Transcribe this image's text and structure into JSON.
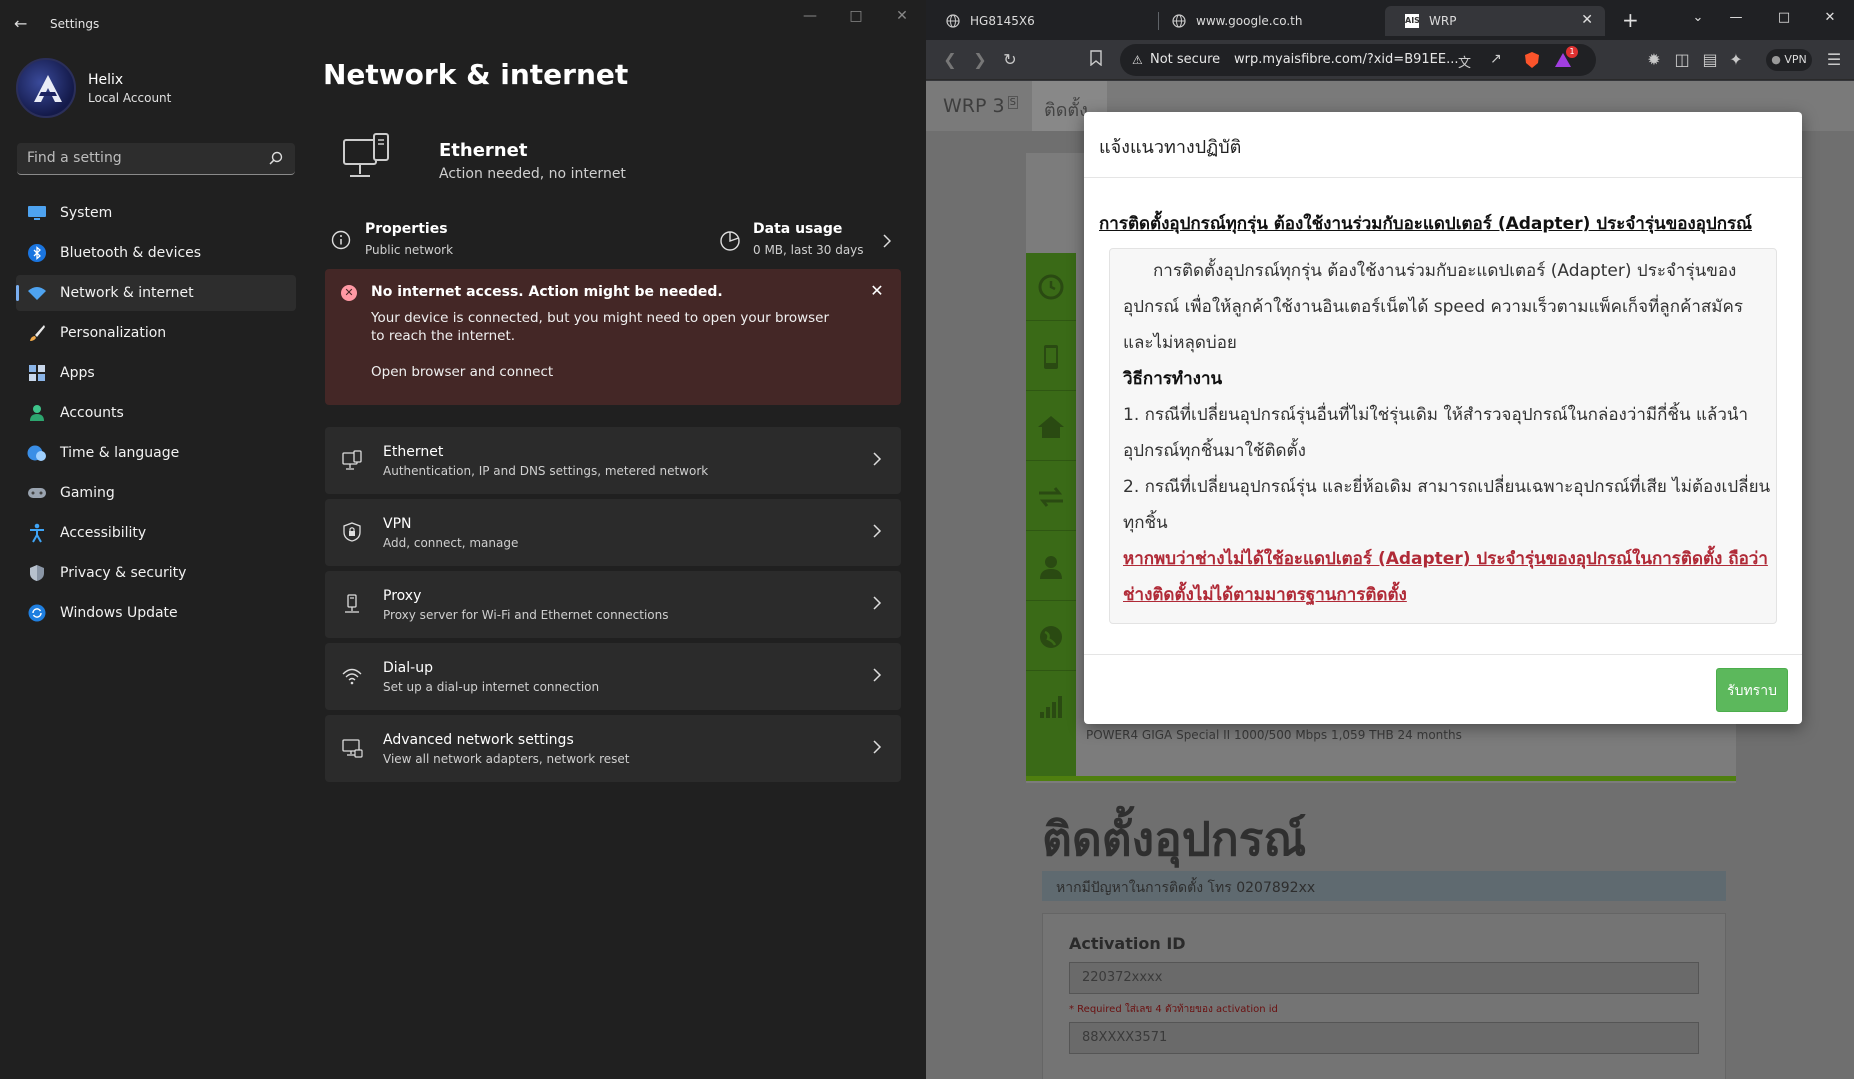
{
  "settings": {
    "app_title": "Settings",
    "profile": {
      "name": "Helix",
      "account_type": "Local Account"
    },
    "search": {
      "placeholder": "Find a setting"
    },
    "nav": [
      {
        "label": "System",
        "icon": "monitor-icon"
      },
      {
        "label": "Bluetooth & devices",
        "icon": "bluetooth-icon"
      },
      {
        "label": "Network & internet",
        "icon": "wifi-icon",
        "active": true
      },
      {
        "label": "Personalization",
        "icon": "brush-icon"
      },
      {
        "label": "Apps",
        "icon": "apps-icon"
      },
      {
        "label": "Accounts",
        "icon": "person-icon"
      },
      {
        "label": "Time & language",
        "icon": "globe-clock-icon"
      },
      {
        "label": "Gaming",
        "icon": "gamepad-icon"
      },
      {
        "label": "Accessibility",
        "icon": "accessibility-icon"
      },
      {
        "label": "Privacy & security",
        "icon": "shield-icon"
      },
      {
        "label": "Windows Update",
        "icon": "update-icon"
      }
    ],
    "page_title": "Network & internet",
    "ethernet_hero": {
      "title": "Ethernet",
      "status": "Action needed, no internet"
    },
    "properties": {
      "title": "Properties",
      "sub": "Public network"
    },
    "data_usage": {
      "title": "Data usage",
      "sub": "0 MB, last 30 days"
    },
    "alert": {
      "title": "No internet access. Action might be needed.",
      "body": "Your device is connected, but you might need to open your browser to reach the internet.",
      "link": "Open browser and connect"
    },
    "cards": [
      {
        "title": "Ethernet",
        "sub": "Authentication, IP and DNS settings, metered network",
        "icon": "ethernet-icon"
      },
      {
        "title": "VPN",
        "sub": "Add, connect, manage",
        "icon": "vpn-shield-icon"
      },
      {
        "title": "Proxy",
        "sub": "Proxy server for Wi-Fi and Ethernet connections",
        "icon": "proxy-icon"
      },
      {
        "title": "Dial-up",
        "sub": "Set up a dial-up internet connection",
        "icon": "dialup-icon"
      },
      {
        "title": "Advanced network settings",
        "sub": "View all network adapters, network reset",
        "icon": "network-adapter-icon"
      }
    ]
  },
  "browser": {
    "tabs": [
      {
        "label": "HG8145X6",
        "active": false
      },
      {
        "label": "www.google.co.th",
        "active": false
      },
      {
        "label": "WRP",
        "active": true
      }
    ],
    "address": {
      "security": "Not secure",
      "url": "wrp.myaisfibre.com/?xid=B91EE..."
    },
    "badge_count": "1",
    "vpn_label": "VPN",
    "page": {
      "nav_brand": "WRP 3",
      "nav_brand_sup": "S",
      "nav_tab": "ติดตั้ง",
      "plan": "POWER4 GIGA Special II 1000/500 Mbps 1,059 THB 24 months",
      "heading": "ติดตั้งอุปกรณ์",
      "phone_notice": "หากมีปัญหาในการติดตั้ง โทร 0207892xx",
      "activation_label": "Activation ID",
      "activation_value": "220372xxxx",
      "help_text": "* Required ใส่เลข 4 ตัวท้ายของ activation id",
      "second_value": "88XXXX3571"
    },
    "modal": {
      "title": "แจ้งแนวทางปฏิบัติ",
      "headline": "การติดตั้งอุปกรณ์ทุกรุ่น ต้องใช้งานร่วมกับอะแดปเตอร์ (Adapter) ประจำรุ่นของอุปกรณ์",
      "intro": "การติดตั้งอุปกรณ์ทุกรุ่น ต้องใช้งานร่วมกับอะแดปเตอร์ (Adapter) ประจำรุ่นของอุปกรณ์ เพื่อให้ลูกค้าใช้งานอินเตอร์เน็ตได้ speed ความเร็วตามแพ็คเก็จที่ลูกค้าสมัคร และไม่หลุดบ่อย",
      "method_title": "วิธีการทำงาน",
      "step1": "1. กรณีที่เปลี่ยนอุปกรณ์รุ่นอื่นที่ไม่ใช่รุ่นเดิม ให้สำรวจอุปกรณ์ในกล่องว่ามีกี่ชิ้น แล้วนำอุปกรณ์ทุกชิ้นมาใช้ติดตั้ง",
      "step2": "2. กรณีที่เปลี่ยนอุปกรณ์รุ่น และยี่ห้อเดิม สามารถเปลี่ยนเฉพาะอุปกรณ์ที่เสีย ไม่ต้องเปลี่ยนทุกชิ้น",
      "warning": "หากพบว่าช่างไม่ได้ใช้อะแดปเตอร์ (Adapter) ประจำรุ่นของอุปกรณ์ในการติดตั้ง ถือว่าช่างติดตั้งไม่ได้ตามมาตรฐานการติดตั้ง",
      "button": "รับทราบ"
    }
  },
  "colors": {
    "accent": "#7aaef0",
    "alert_bg": "#442726",
    "ok_button": "#5cb85c",
    "warning_text": "#b02a37",
    "sidebar_green": "#3a6a17"
  }
}
